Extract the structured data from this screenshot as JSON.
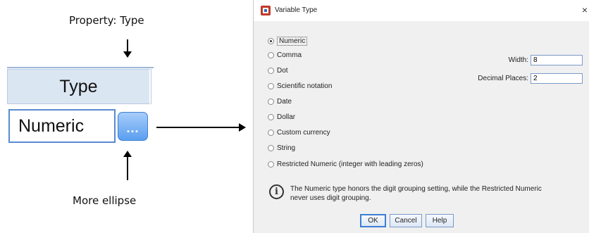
{
  "annotations": {
    "property_label": "Property: Type",
    "more_label": "More ellipse"
  },
  "grid": {
    "column_header": "Type",
    "cell_value": "Numeric",
    "ellipsis_label": "..."
  },
  "dialog": {
    "title": "Variable Type",
    "close_glyph": "×",
    "options": [
      {
        "label": "Numeric",
        "selected": true
      },
      {
        "label": "Comma",
        "selected": false
      },
      {
        "label": "Dot",
        "selected": false
      },
      {
        "label": "Scientific notation",
        "selected": false
      },
      {
        "label": "Date",
        "selected": false
      },
      {
        "label": "Dollar",
        "selected": false
      },
      {
        "label": "Custom currency",
        "selected": false
      },
      {
        "label": "String",
        "selected": false
      },
      {
        "label": "Restricted Numeric (integer with leading zeros)",
        "selected": false
      }
    ],
    "width_label": "Width:",
    "width_value": "8",
    "decimal_label": "Decimal Places:",
    "decimal_value": "2",
    "info_text": "The Numeric type honors the digit grouping setting, while the Restricted Numeric never uses digit grouping.",
    "buttons": {
      "ok": "OK",
      "cancel": "Cancel",
      "help": "Help"
    }
  },
  "colors": {
    "accent": "#3c7fd2",
    "header_bg": "#dbe6f3"
  }
}
